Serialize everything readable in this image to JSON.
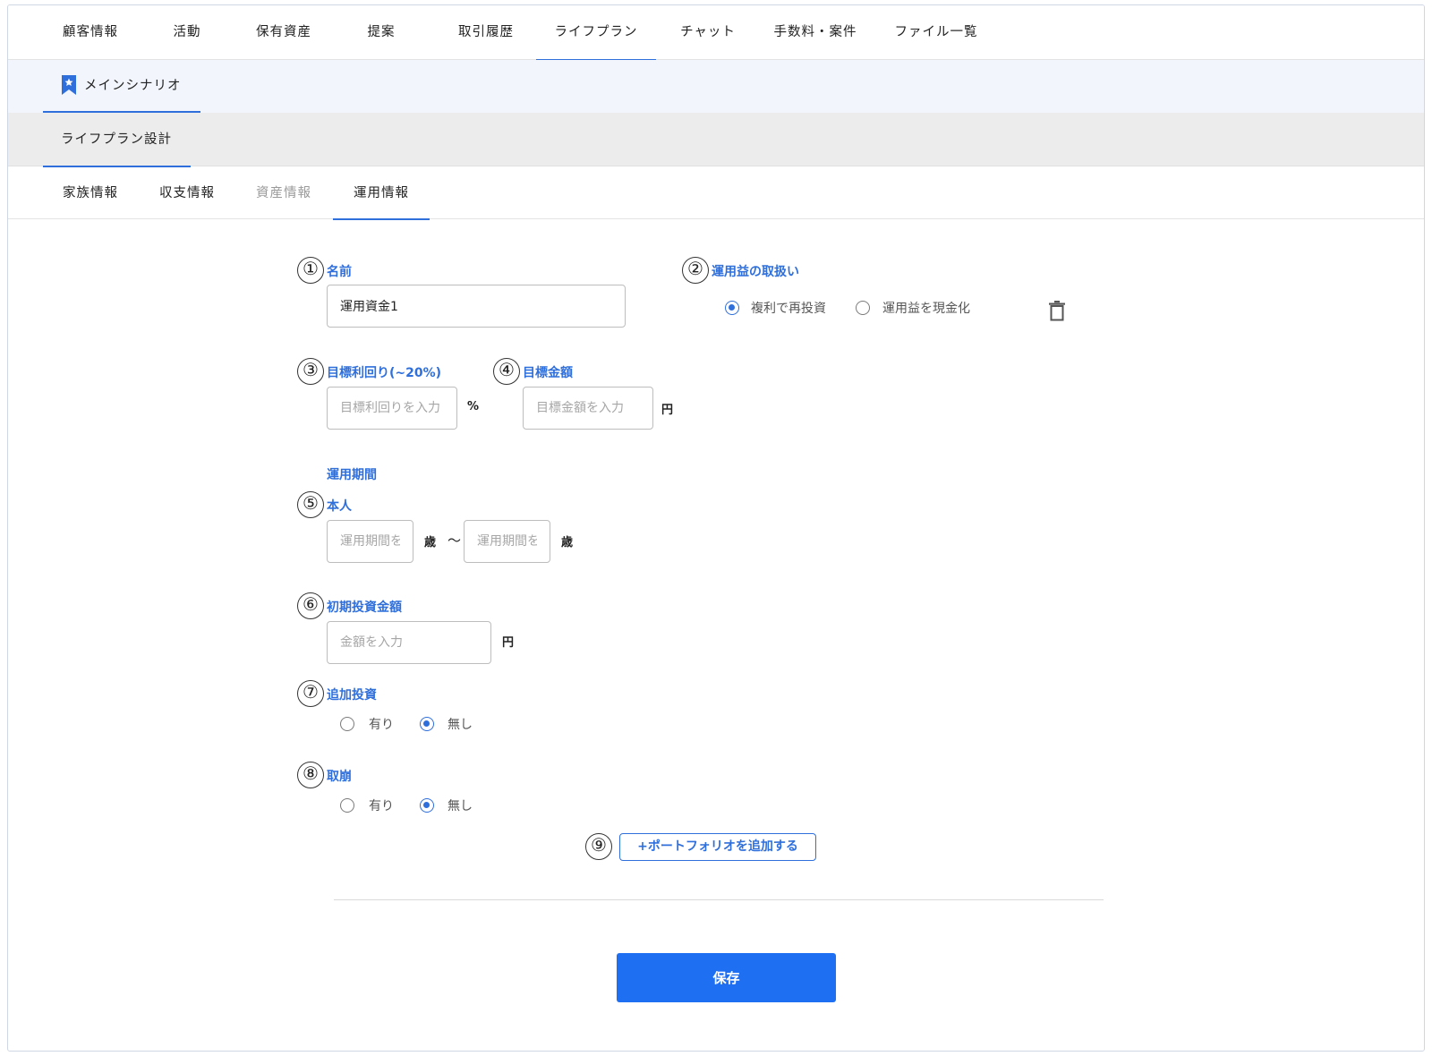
{
  "main_tabs": [
    {
      "label": "顧客情報",
      "active": false
    },
    {
      "label": "活動",
      "active": false
    },
    {
      "label": "保有資産",
      "active": false
    },
    {
      "label": "提案",
      "active": false
    },
    {
      "label": "取引履歴",
      "active": false
    },
    {
      "label": "ライフプラン",
      "active": true
    },
    {
      "label": "チャット",
      "active": false
    },
    {
      "label": "手数料・案件",
      "active": false
    },
    {
      "label": "ファイル一覧",
      "active": false
    }
  ],
  "scenario": {
    "label": "メインシナリオ",
    "icon": "bookmark-star-icon"
  },
  "design": {
    "label": "ライフプラン設計"
  },
  "sub_tabs": [
    {
      "label": "家族情報",
      "state": "normal"
    },
    {
      "label": "収支情報",
      "state": "normal"
    },
    {
      "label": "資産情報",
      "state": "disabled"
    },
    {
      "label": "運用情報",
      "state": "active"
    }
  ],
  "markers": [
    "①",
    "②",
    "③",
    "④",
    "⑤",
    "⑥",
    "⑦",
    "⑧",
    "⑨"
  ],
  "form": {
    "name": {
      "label": "名前",
      "value": "運用資金1"
    },
    "profit_handling": {
      "label": "運用益の取扱い",
      "options": [
        {
          "label": "複利で再投資",
          "checked": true
        },
        {
          "label": "運用益を現金化",
          "checked": false
        }
      ]
    },
    "target_yield": {
      "label": "目標利回り(~20%)",
      "placeholder": "目標利回りを入力",
      "unit": "%"
    },
    "target_amount": {
      "label": "目標金額",
      "placeholder": "目標金額を入力",
      "unit": "円"
    },
    "period": {
      "section_label": "運用期間",
      "person_label": "本人",
      "from_placeholder": "運用期間を入力",
      "to_placeholder": "運用期間を入力",
      "unit": "歳",
      "separator": "〜"
    },
    "initial_amount": {
      "label": "初期投資金額",
      "placeholder": "金額を入力",
      "unit": "円"
    },
    "additional_investment": {
      "label": "追加投資",
      "options": [
        {
          "label": "有り",
          "checked": false
        },
        {
          "label": "無し",
          "checked": true
        }
      ]
    },
    "withdrawal": {
      "label": "取崩",
      "options": [
        {
          "label": "有り",
          "checked": false
        },
        {
          "label": "無し",
          "checked": true
        }
      ]
    },
    "add_portfolio_label": "+ポートフォリオを追加する"
  },
  "save_label": "保存",
  "colors": {
    "accent": "#2f6fdc",
    "save_button": "#1f6ff2",
    "scenario_bg": "#f2f6fc",
    "design_bg": "#ececec"
  }
}
